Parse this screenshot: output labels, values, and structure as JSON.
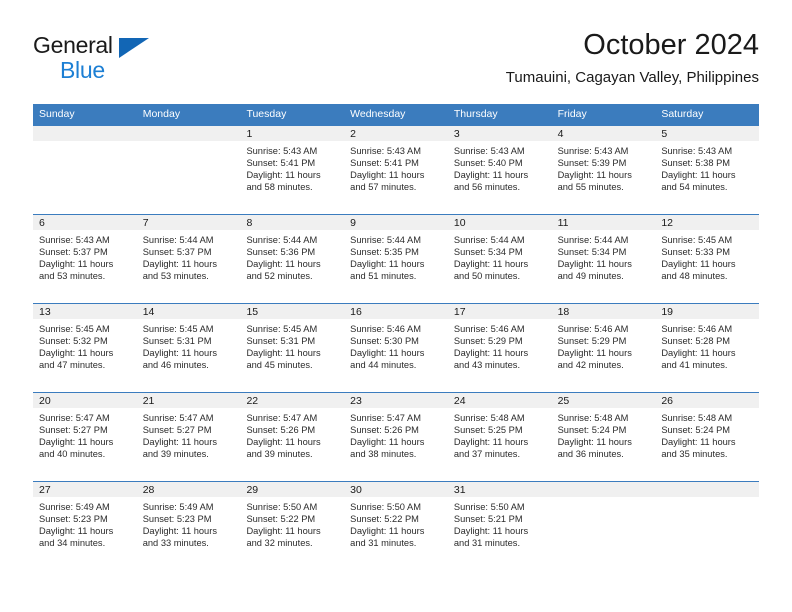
{
  "brand": {
    "word1": "General",
    "word2": "Blue",
    "triangle_color": "#1266b5",
    "blue_color": "#1c7fd4"
  },
  "header": {
    "title": "October 2024",
    "subtitle": "Tumauini, Cagayan Valley, Philippines"
  },
  "theme": {
    "header_bg": "#3b7cbe",
    "header_text": "#ffffff",
    "daynum_band": "#f0f0f0",
    "cell_border": "#3b7cbe"
  },
  "weekdays": [
    "Sunday",
    "Monday",
    "Tuesday",
    "Wednesday",
    "Thursday",
    "Friday",
    "Saturday"
  ],
  "weeks": [
    [
      {
        "day": "",
        "sunrise": "",
        "sunset": "",
        "daylight1": "",
        "daylight2": ""
      },
      {
        "day": "",
        "sunrise": "",
        "sunset": "",
        "daylight1": "",
        "daylight2": ""
      },
      {
        "day": "1",
        "sunrise": "Sunrise: 5:43 AM",
        "sunset": "Sunset: 5:41 PM",
        "daylight1": "Daylight: 11 hours",
        "daylight2": "and 58 minutes."
      },
      {
        "day": "2",
        "sunrise": "Sunrise: 5:43 AM",
        "sunset": "Sunset: 5:41 PM",
        "daylight1": "Daylight: 11 hours",
        "daylight2": "and 57 minutes."
      },
      {
        "day": "3",
        "sunrise": "Sunrise: 5:43 AM",
        "sunset": "Sunset: 5:40 PM",
        "daylight1": "Daylight: 11 hours",
        "daylight2": "and 56 minutes."
      },
      {
        "day": "4",
        "sunrise": "Sunrise: 5:43 AM",
        "sunset": "Sunset: 5:39 PM",
        "daylight1": "Daylight: 11 hours",
        "daylight2": "and 55 minutes."
      },
      {
        "day": "5",
        "sunrise": "Sunrise: 5:43 AM",
        "sunset": "Sunset: 5:38 PM",
        "daylight1": "Daylight: 11 hours",
        "daylight2": "and 54 minutes."
      }
    ],
    [
      {
        "day": "6",
        "sunrise": "Sunrise: 5:43 AM",
        "sunset": "Sunset: 5:37 PM",
        "daylight1": "Daylight: 11 hours",
        "daylight2": "and 53 minutes."
      },
      {
        "day": "7",
        "sunrise": "Sunrise: 5:44 AM",
        "sunset": "Sunset: 5:37 PM",
        "daylight1": "Daylight: 11 hours",
        "daylight2": "and 53 minutes."
      },
      {
        "day": "8",
        "sunrise": "Sunrise: 5:44 AM",
        "sunset": "Sunset: 5:36 PM",
        "daylight1": "Daylight: 11 hours",
        "daylight2": "and 52 minutes."
      },
      {
        "day": "9",
        "sunrise": "Sunrise: 5:44 AM",
        "sunset": "Sunset: 5:35 PM",
        "daylight1": "Daylight: 11 hours",
        "daylight2": "and 51 minutes."
      },
      {
        "day": "10",
        "sunrise": "Sunrise: 5:44 AM",
        "sunset": "Sunset: 5:34 PM",
        "daylight1": "Daylight: 11 hours",
        "daylight2": "and 50 minutes."
      },
      {
        "day": "11",
        "sunrise": "Sunrise: 5:44 AM",
        "sunset": "Sunset: 5:34 PM",
        "daylight1": "Daylight: 11 hours",
        "daylight2": "and 49 minutes."
      },
      {
        "day": "12",
        "sunrise": "Sunrise: 5:45 AM",
        "sunset": "Sunset: 5:33 PM",
        "daylight1": "Daylight: 11 hours",
        "daylight2": "and 48 minutes."
      }
    ],
    [
      {
        "day": "13",
        "sunrise": "Sunrise: 5:45 AM",
        "sunset": "Sunset: 5:32 PM",
        "daylight1": "Daylight: 11 hours",
        "daylight2": "and 47 minutes."
      },
      {
        "day": "14",
        "sunrise": "Sunrise: 5:45 AM",
        "sunset": "Sunset: 5:31 PM",
        "daylight1": "Daylight: 11 hours",
        "daylight2": "and 46 minutes."
      },
      {
        "day": "15",
        "sunrise": "Sunrise: 5:45 AM",
        "sunset": "Sunset: 5:31 PM",
        "daylight1": "Daylight: 11 hours",
        "daylight2": "and 45 minutes."
      },
      {
        "day": "16",
        "sunrise": "Sunrise: 5:46 AM",
        "sunset": "Sunset: 5:30 PM",
        "daylight1": "Daylight: 11 hours",
        "daylight2": "and 44 minutes."
      },
      {
        "day": "17",
        "sunrise": "Sunrise: 5:46 AM",
        "sunset": "Sunset: 5:29 PM",
        "daylight1": "Daylight: 11 hours",
        "daylight2": "and 43 minutes."
      },
      {
        "day": "18",
        "sunrise": "Sunrise: 5:46 AM",
        "sunset": "Sunset: 5:29 PM",
        "daylight1": "Daylight: 11 hours",
        "daylight2": "and 42 minutes."
      },
      {
        "day": "19",
        "sunrise": "Sunrise: 5:46 AM",
        "sunset": "Sunset: 5:28 PM",
        "daylight1": "Daylight: 11 hours",
        "daylight2": "and 41 minutes."
      }
    ],
    [
      {
        "day": "20",
        "sunrise": "Sunrise: 5:47 AM",
        "sunset": "Sunset: 5:27 PM",
        "daylight1": "Daylight: 11 hours",
        "daylight2": "and 40 minutes."
      },
      {
        "day": "21",
        "sunrise": "Sunrise: 5:47 AM",
        "sunset": "Sunset: 5:27 PM",
        "daylight1": "Daylight: 11 hours",
        "daylight2": "and 39 minutes."
      },
      {
        "day": "22",
        "sunrise": "Sunrise: 5:47 AM",
        "sunset": "Sunset: 5:26 PM",
        "daylight1": "Daylight: 11 hours",
        "daylight2": "and 39 minutes."
      },
      {
        "day": "23",
        "sunrise": "Sunrise: 5:47 AM",
        "sunset": "Sunset: 5:26 PM",
        "daylight1": "Daylight: 11 hours",
        "daylight2": "and 38 minutes."
      },
      {
        "day": "24",
        "sunrise": "Sunrise: 5:48 AM",
        "sunset": "Sunset: 5:25 PM",
        "daylight1": "Daylight: 11 hours",
        "daylight2": "and 37 minutes."
      },
      {
        "day": "25",
        "sunrise": "Sunrise: 5:48 AM",
        "sunset": "Sunset: 5:24 PM",
        "daylight1": "Daylight: 11 hours",
        "daylight2": "and 36 minutes."
      },
      {
        "day": "26",
        "sunrise": "Sunrise: 5:48 AM",
        "sunset": "Sunset: 5:24 PM",
        "daylight1": "Daylight: 11 hours",
        "daylight2": "and 35 minutes."
      }
    ],
    [
      {
        "day": "27",
        "sunrise": "Sunrise: 5:49 AM",
        "sunset": "Sunset: 5:23 PM",
        "daylight1": "Daylight: 11 hours",
        "daylight2": "and 34 minutes."
      },
      {
        "day": "28",
        "sunrise": "Sunrise: 5:49 AM",
        "sunset": "Sunset: 5:23 PM",
        "daylight1": "Daylight: 11 hours",
        "daylight2": "and 33 minutes."
      },
      {
        "day": "29",
        "sunrise": "Sunrise: 5:50 AM",
        "sunset": "Sunset: 5:22 PM",
        "daylight1": "Daylight: 11 hours",
        "daylight2": "and 32 minutes."
      },
      {
        "day": "30",
        "sunrise": "Sunrise: 5:50 AM",
        "sunset": "Sunset: 5:22 PM",
        "daylight1": "Daylight: 11 hours",
        "daylight2": "and 31 minutes."
      },
      {
        "day": "31",
        "sunrise": "Sunrise: 5:50 AM",
        "sunset": "Sunset: 5:21 PM",
        "daylight1": "Daylight: 11 hours",
        "daylight2": "and 31 minutes."
      },
      {
        "day": "",
        "sunrise": "",
        "sunset": "",
        "daylight1": "",
        "daylight2": ""
      },
      {
        "day": "",
        "sunrise": "",
        "sunset": "",
        "daylight1": "",
        "daylight2": ""
      }
    ]
  ]
}
